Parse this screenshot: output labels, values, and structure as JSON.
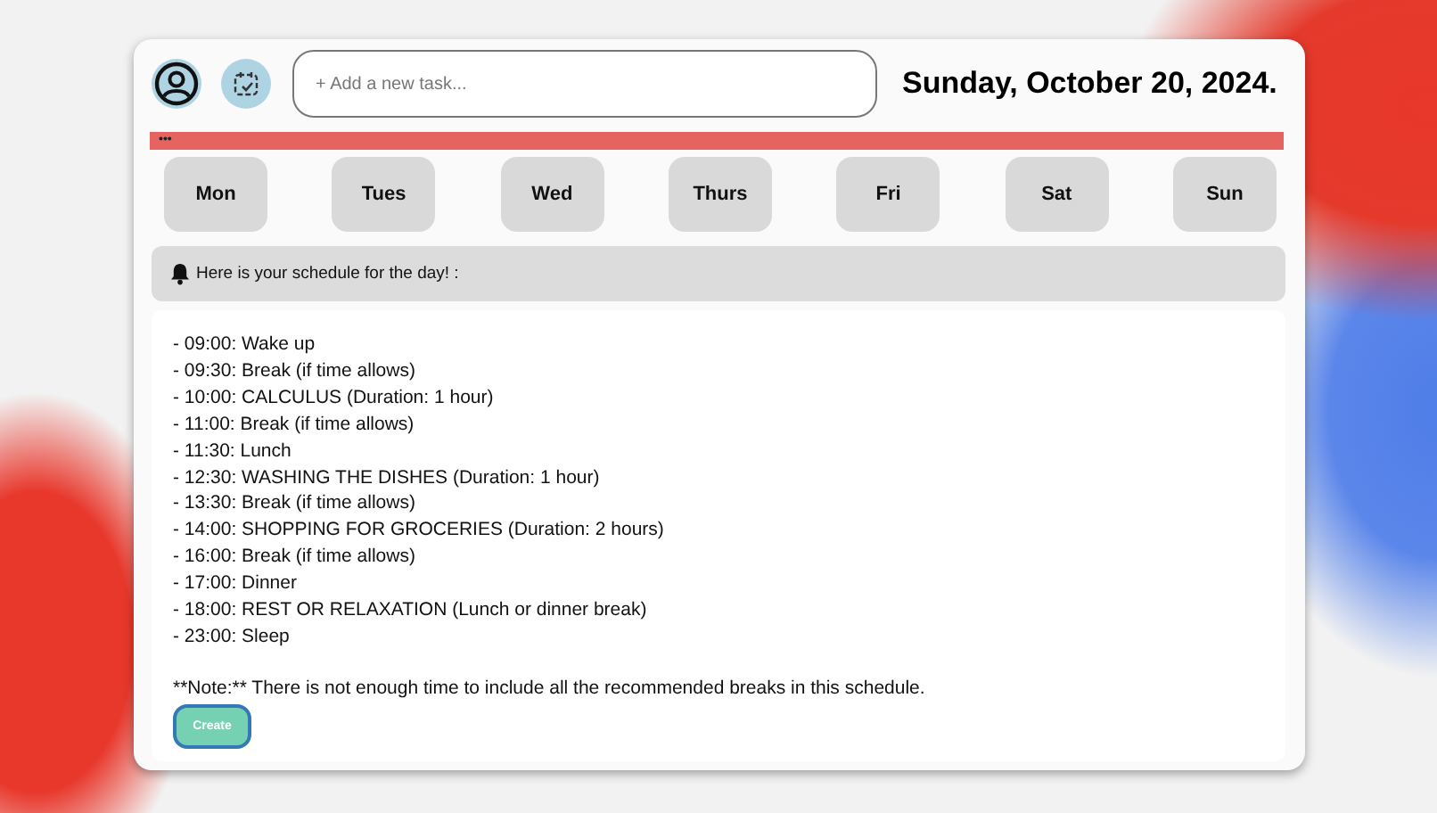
{
  "header": {
    "task_input": {
      "placeholder": "+ Add a new task..."
    },
    "date": "Sunday, October 20, 2024."
  },
  "banner": {
    "text": "•••"
  },
  "days": [
    {
      "label": "Mon"
    },
    {
      "label": "Tues"
    },
    {
      "label": "Wed"
    },
    {
      "label": "Thurs"
    },
    {
      "label": "Fri"
    },
    {
      "label": "Sat"
    },
    {
      "label": "Sun"
    }
  ],
  "notice": {
    "text": "Here is your schedule for the day! :"
  },
  "schedule": {
    "items": [
      "- 09:00: Wake up",
      "- 09:30: Break (if time allows)",
      "- 10:00: CALCULUS (Duration: 1 hour)",
      "- 11:00: Break (if time allows)",
      "- 11:30: Lunch",
      "- 12:30: WASHING THE DISHES (Duration: 1 hour)",
      "- 13:30: Break (if time allows)",
      "- 14:00: SHOPPING FOR GROCERIES (Duration: 2 hours)",
      "- 16:00: Break (if time allows)",
      "- 17:00: Dinner",
      "- 18:00: REST OR RELAXATION (Lunch or dinner break)",
      "- 23:00: Sleep"
    ],
    "note": "**Note:** There is not enough time to include all the recommended breaks in this schedule.",
    "button": "Create"
  }
}
